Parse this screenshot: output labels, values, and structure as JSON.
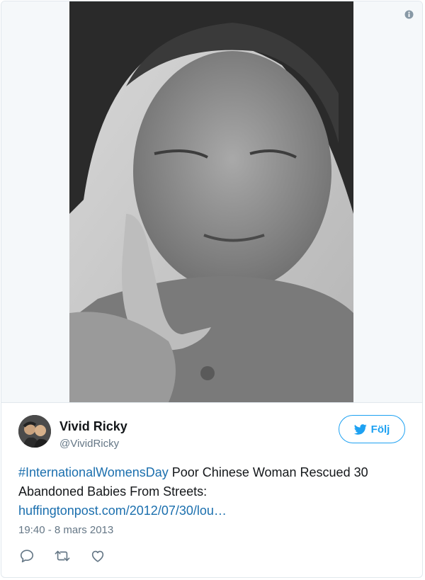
{
  "tweet": {
    "author_name": "Vivid Ricky",
    "author_handle": "@VividRicky",
    "follow_label": "Följ",
    "hashtag": "#InternationalWomensDay",
    "text_line": " Poor Chinese Woman Rescued 30 Abandoned Babies From Streets: ",
    "link": "huffingtonpost.com/2012/07/30/lou…",
    "timestamp": "19:40 - 8 mars 2013"
  },
  "icons": {
    "info": "info-icon",
    "follow": "twitter-bird-icon",
    "reply": "reply-icon",
    "retweet": "retweet-icon",
    "like": "heart-icon"
  },
  "colors": {
    "accent": "#1da1f2",
    "link": "#1b6fae",
    "text": "#14171a",
    "muted": "#657786",
    "border": "#e1e8ed"
  }
}
